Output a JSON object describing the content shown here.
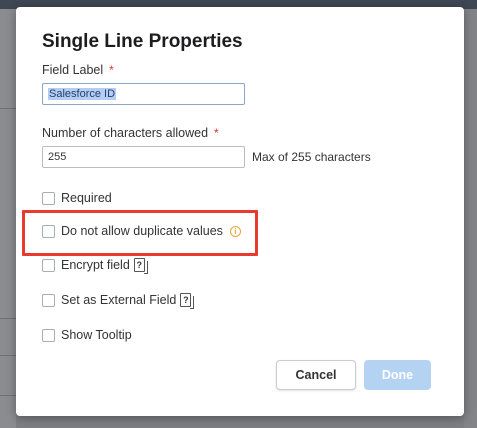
{
  "dialog": {
    "title": "Single Line Properties",
    "field_label": {
      "label": "Field Label",
      "required_marker": "*",
      "value": "Salesforce ID"
    },
    "char_limit": {
      "label": "Number of characters allowed",
      "required_marker": "*",
      "value": "255",
      "hint": "Max of 255 characters"
    },
    "options": [
      {
        "label": "Required",
        "checked": false
      },
      {
        "label": "Do not allow duplicate values",
        "checked": false,
        "icon": "info-icon"
      },
      {
        "label": "Encrypt field",
        "checked": false,
        "icon": "help-icon"
      },
      {
        "label": "Set as External Field",
        "checked": false,
        "icon": "help-icon"
      },
      {
        "label": "Show Tooltip",
        "checked": false
      }
    ],
    "buttons": {
      "cancel": "Cancel",
      "done": "Done"
    },
    "colors": {
      "required": "#e0312b",
      "highlight": "#e93a2e",
      "done_disabled": "#b4d3f3",
      "info_icon": "#e8a33c"
    }
  }
}
